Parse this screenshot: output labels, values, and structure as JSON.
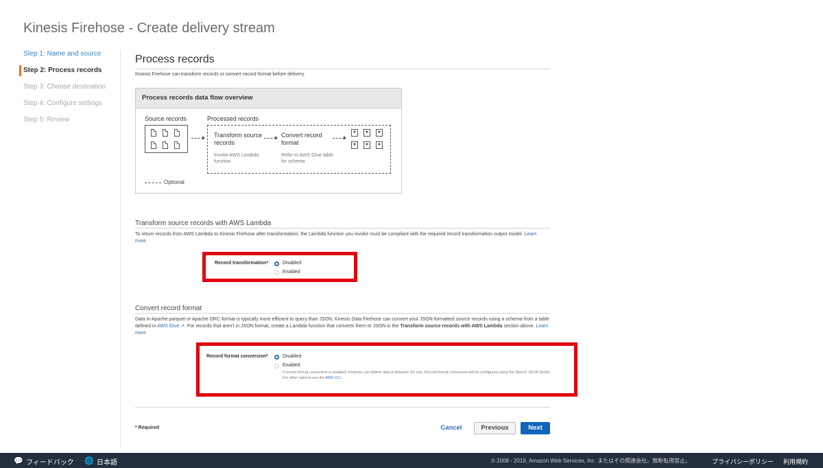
{
  "page": {
    "title": "Kinesis Firehose - Create delivery stream"
  },
  "steps": [
    {
      "label": "Step 1: Name and source",
      "state": "done"
    },
    {
      "label": "Step 2: Process records",
      "state": "active"
    },
    {
      "label": "Step 3: Choose destination",
      "state": "todo"
    },
    {
      "label": "Step 4: Configure settings",
      "state": "todo"
    },
    {
      "label": "Step 5: Review",
      "state": "todo"
    }
  ],
  "section": {
    "title": "Process records",
    "intro": "Kinesis Firehose can transform records or convert record format before delivery."
  },
  "flow": {
    "header": "Process records data flow overview",
    "source_label": "Source records",
    "processed_label": "Processed records",
    "transform_title": "Transform source records",
    "transform_sub": "Invoke AWS Lambda function",
    "convert_title": "Convert record format",
    "convert_sub": "Refer to AWS Glue table for schema",
    "optional_label": "Optional"
  },
  "lambda": {
    "heading": "Transform source records with AWS Lambda",
    "desc": "To return records from AWS Lambda to Kinesis Firehose after transformation, the Lambda function you invoke must be compliant with the required record transformation output model.",
    "learn_more": "Learn more",
    "field_label": "Record transformation*",
    "options": [
      "Disabled",
      "Enabled"
    ],
    "selected": "Disabled"
  },
  "convert": {
    "heading": "Convert record format",
    "desc_1": "Data in Apache parquet or Apache ORC format is typically more efficient to query than JSON. Kinesis Data Firehose can convert your JSON-formatted source records using a schema from a table defined in",
    "glue_link": "AWS Glue",
    "desc_2": ". For records that aren't in JSON format, create a Lambda function that converts them to JSON in the",
    "desc_bold": "Transform source records with AWS Lambda",
    "desc_3": "section above.",
    "learn_more": "Learn more",
    "field_label": "Record format conversion*",
    "options": [
      "Disabled",
      "Enabled"
    ],
    "selected": "Disabled",
    "note": "If record format conversion is enabled, Firehose can deliver data to Amazon S3 only. Record format conversion will be configured using the OpenX JSON SerDe. For other options use the",
    "note_link": "AWS CLI",
    "note_end": "."
  },
  "form": {
    "required_note": "* Required",
    "cancel": "Cancel",
    "previous": "Previous",
    "next": "Next"
  },
  "footer": {
    "feedback": "フィードバック",
    "language": "日本語",
    "copyright": "© 2008 - 2019, Amazon Web Services, Inc. またはその関連会社。無断転用禁止。",
    "privacy": "プライバシーポリシー",
    "terms": "利用規約"
  },
  "colors": {
    "link": "#2a6db0",
    "primary_button": "#1166bb",
    "highlight_box": "#e3000f",
    "active_step_marker": "#ec7211"
  }
}
